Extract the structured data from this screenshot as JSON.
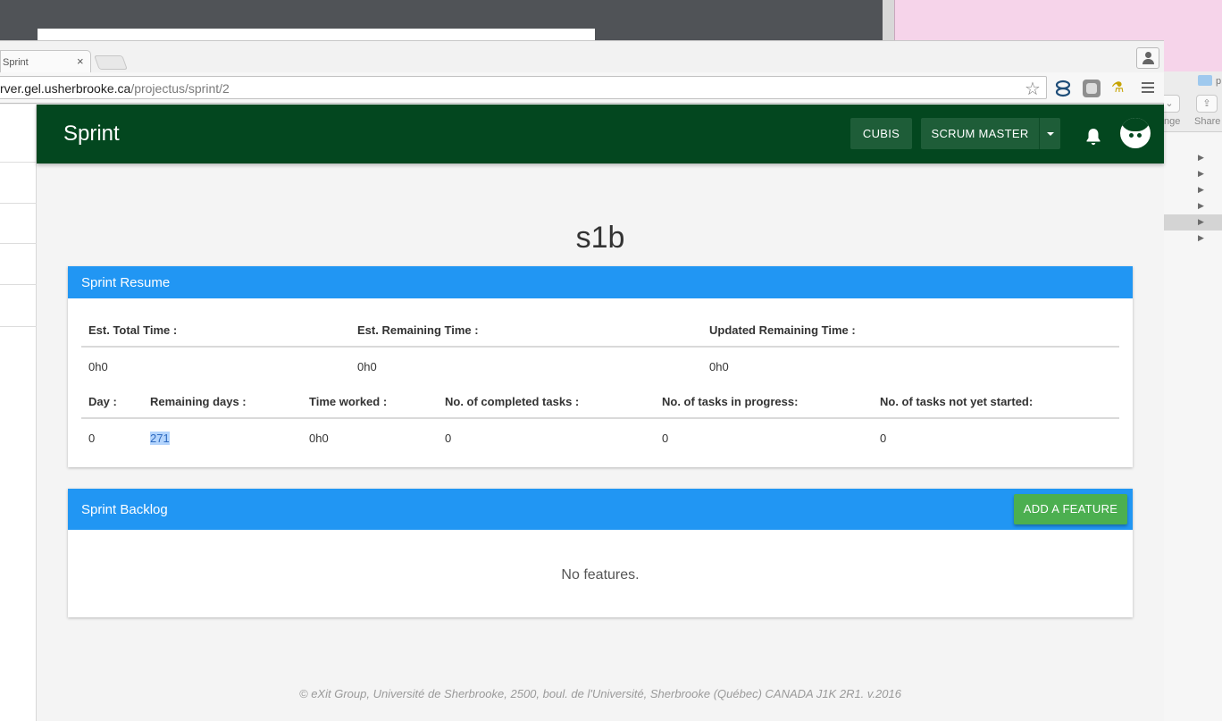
{
  "browser": {
    "tab_title": "Sprint",
    "tab_close": "×",
    "url_host": "rver.gel.usherbrooke.ca",
    "url_path": "/projectus/sprint/2"
  },
  "finder": {
    "toolbar_labels": [
      "nge",
      "Share"
    ],
    "folder_label": "p"
  },
  "appbar": {
    "title": "Sprint",
    "project_button": "CUBIS",
    "role_button": "SCRUM MASTER",
    "color": "#03471f"
  },
  "page": {
    "heading": "s1b"
  },
  "resume": {
    "title": "Sprint Resume",
    "header_color": "#2196f3",
    "row1_labels": [
      "Est. Total Time :",
      "Est. Remaining Time :",
      "Updated Remaining Time :"
    ],
    "row1_values": [
      "0h0",
      "0h0",
      "0h0"
    ],
    "row2_labels": [
      "Day :",
      "Remaining days :",
      "Time worked :",
      "No. of completed tasks :",
      "No. of tasks in progress:",
      "No. of tasks not yet started:"
    ],
    "row2_values": [
      "0",
      "271",
      "0h0",
      "0",
      "0",
      "0"
    ]
  },
  "backlog": {
    "title": "Sprint Backlog",
    "add_button": "ADD A FEATURE",
    "button_color": "#4caf50",
    "empty_text": "No features."
  },
  "footer": {
    "text": "© eXit Group, Université de Sherbrooke, 2500, boul. de l'Université, Sherbrooke (Québec) CANADA J1K 2R1. v.2016"
  },
  "icons": [
    "star-icon",
    "bell-icon",
    "avatar",
    "menu-icon",
    "profile-icon",
    "caret-down-icon"
  ]
}
